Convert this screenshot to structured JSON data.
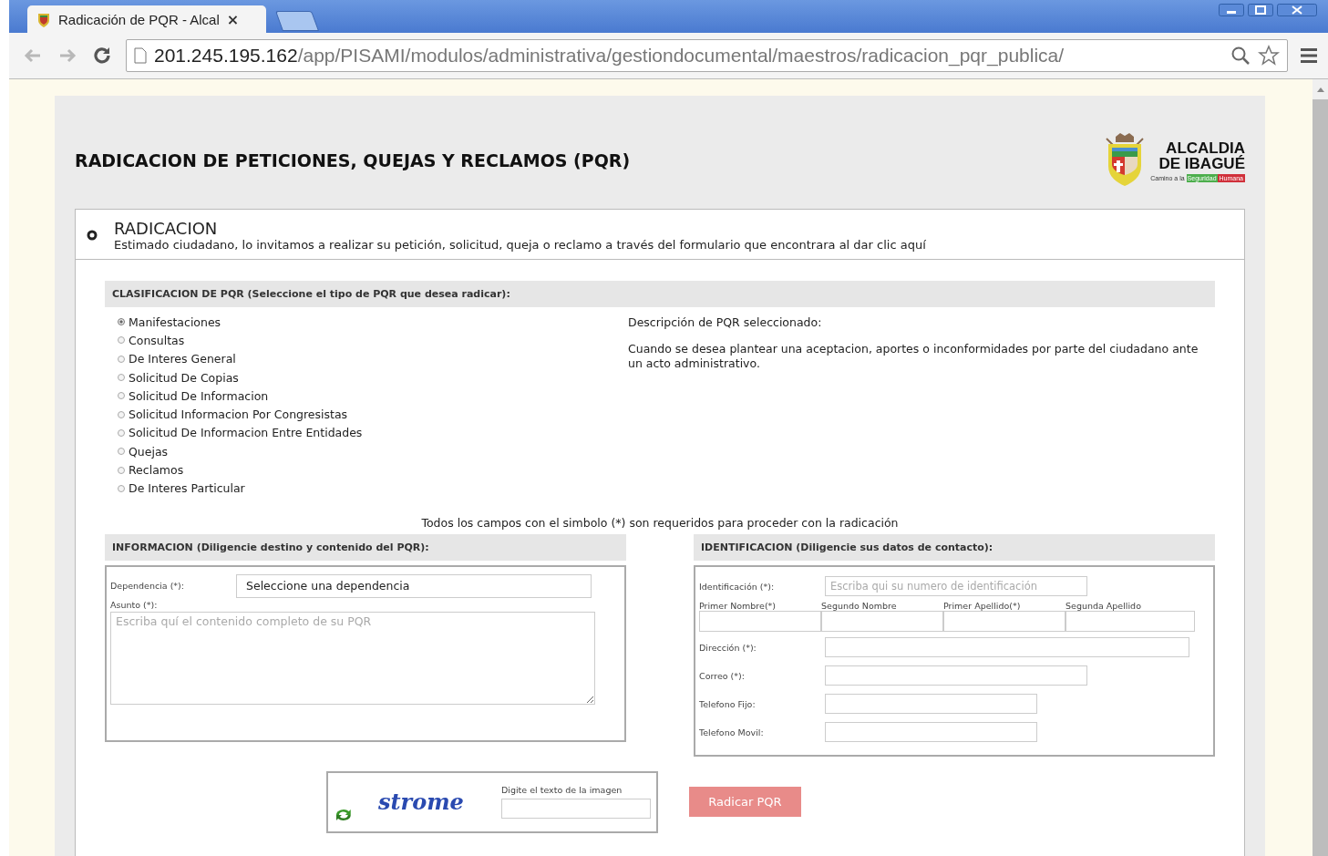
{
  "browser": {
    "tab_title": "Radicación de PQR - Alcal",
    "tab_close": "×",
    "url_host": "201.245.195.162",
    "url_path": "/app/PISAMI/modulos/administrativa/gestiondocumental/maestros/radicacion_pqr_publica/"
  },
  "page": {
    "title": "RADICACION DE PETICIONES, QUEJAS Y RECLAMOS (PQR)",
    "logo": {
      "line1": "ALCALDIA",
      "line2": "DE IBAGUÉ",
      "tagline": "Camino a la",
      "badge_a": "Seguridad",
      "badge_b": "Humana"
    }
  },
  "section": {
    "title": "RADICACION",
    "subtitle": "Estimado ciudadano, lo invitamos a realizar su petición, solicitud, queja o reclamo a través del formulario que encontrara al dar clic aquí"
  },
  "classification": {
    "heading": "CLASIFICACION DE PQR (Seleccione el tipo de PQR que desea radicar):",
    "options": [
      {
        "label": "Manifestaciones",
        "selected": true
      },
      {
        "label": "Consultas",
        "selected": false
      },
      {
        "label": "De Interes General",
        "selected": false
      },
      {
        "label": "Solicitud De Copias",
        "selected": false
      },
      {
        "label": "Solicitud De Informacion",
        "selected": false
      },
      {
        "label": "Solicitud Informacion Por Congresistas",
        "selected": false
      },
      {
        "label": "Solicitud De Informacion Entre Entidades",
        "selected": false
      },
      {
        "label": "Quejas",
        "selected": false
      },
      {
        "label": "Reclamos",
        "selected": false
      },
      {
        "label": "De Interes Particular",
        "selected": false
      }
    ],
    "description_label": "Descripción de PQR seleccionado:",
    "description": "Cuando se desea plantear una aceptacion, aportes o inconformidades por parte del ciudadano ante un acto administrativo."
  },
  "required_note": "Todos los campos con el simbolo (*) son requeridos para proceder con la radicación",
  "information": {
    "heading": "INFORMACION (Diligencie destino y contenido del PQR):",
    "dependency_label": "Dependencia (*):",
    "dependency_value": "Seleccione una dependencia",
    "subject_label": "Asunto (*):",
    "subject_placeholder": "Escriba quí el contenido completo de su PQR"
  },
  "identification": {
    "heading": "IDENTIFICACION (Diligencie sus datos de contacto):",
    "id_label": "Identificación (*):",
    "id_placeholder": "Escriba qui su numero de identificación",
    "name_columns": [
      "Primer Nombre(*)",
      "Segundo Nombre",
      "Primer Apellido(*)",
      "Segunda Apellido"
    ],
    "fields": [
      {
        "label": "Dirección (*):",
        "kind": "long"
      },
      {
        "label": "Correo (*):",
        "kind": "medium"
      },
      {
        "label": "Telefono Fijo:",
        "kind": "short"
      },
      {
        "label": "Telefono Movil:",
        "kind": "short"
      }
    ]
  },
  "captcha": {
    "image_text": "strome",
    "label": "Digite el texto de la imagen"
  },
  "submit_button": "Radicar PQR"
}
